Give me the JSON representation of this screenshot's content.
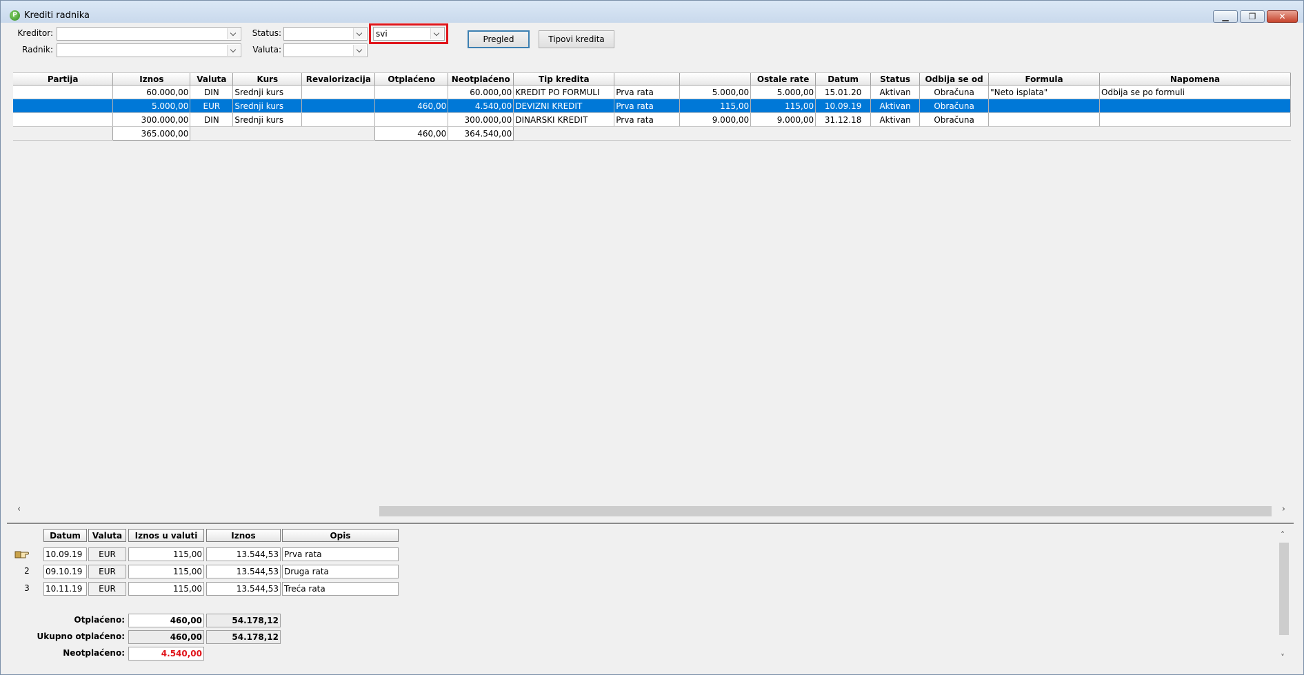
{
  "window": {
    "title": "Krediti radnika",
    "icon": "app-logo-icon"
  },
  "filters": {
    "kreditor_label": "Kreditor:",
    "kreditor_value": "",
    "radnik_label": "Radnik:",
    "radnik_value": "",
    "status_label": "Status:",
    "status_value": "",
    "valuta_label": "Valuta:",
    "valuta_value": "",
    "scope_value": "svi"
  },
  "buttons": {
    "pregled": "Pregled",
    "tipovi": "Tipovi kredita"
  },
  "grid": {
    "headers": [
      "Partija",
      "Iznos",
      "Valuta",
      "Kurs",
      "Revalorizacija",
      "Otplaćeno",
      "Neotplaćeno",
      "Tip kredita",
      "",
      "",
      "Ostale rate",
      "Datum",
      "Status",
      "Odbija se od",
      "Formula",
      "Napomena"
    ],
    "rows": [
      [
        "",
        "60.000,00",
        "DIN",
        "Srednji kurs",
        "",
        "",
        "60.000,00",
        "KREDIT PO FORMULI",
        "Prva rata",
        "5.000,00",
        "5.000,00",
        "15.01.20",
        "Aktivan",
        "Obračuna",
        "\"Neto isplata\"",
        "Odbija se po formuli"
      ],
      [
        "",
        "5.000,00",
        "EUR",
        "Srednji kurs",
        "",
        "460,00",
        "4.540,00",
        "DEVIZNI KREDIT",
        "Prva rata",
        "115,00",
        "115,00",
        "10.09.19",
        "Aktivan",
        "Obračuna",
        "",
        ""
      ],
      [
        "",
        "300.000,00",
        "DIN",
        "Srednji kurs",
        "",
        "",
        "300.000,00",
        "DINARSKI KREDIT",
        "Prva rata",
        "9.000,00",
        "9.000,00",
        "31.12.18",
        "Aktivan",
        "Obračuna",
        "",
        ""
      ]
    ],
    "selected_row": 1,
    "totals": {
      "iznos": "365.000,00",
      "otplaceno": "460,00",
      "neotplaceno": "364.540,00"
    }
  },
  "detail": {
    "headers": [
      "Datum",
      "Valuta",
      "Iznos u valuti",
      "Iznos",
      "Opis"
    ],
    "rows": [
      {
        "num": "",
        "datum": "10.09.19",
        "valuta": "EUR",
        "iznos_valuta": "115,00",
        "iznos": "13.544,53",
        "opis": "Prva rata"
      },
      {
        "num": "2",
        "datum": "09.10.19",
        "valuta": "EUR",
        "iznos_valuta": "115,00",
        "iznos": "13.544,53",
        "opis": "Druga rata"
      },
      {
        "num": "3",
        "datum": "10.11.19",
        "valuta": "EUR",
        "iznos_valuta": "115,00",
        "iznos": "13.544,53",
        "opis": "Treća rata"
      }
    ],
    "summary": {
      "otplaceno_label": "Otplaćeno:",
      "otplaceno_valuta": "460,00",
      "otplaceno_iznos": "54.178,12",
      "ukupno_label": "Ukupno otplaćeno:",
      "ukupno_valuta": "460,00",
      "ukupno_iznos": "54.178,12",
      "neotplaceno_label": "Neotplaćeno:",
      "neotplaceno_valuta": "4.540,00"
    }
  },
  "colors": {
    "selection": "#0078d7",
    "highlight_box": "#e0151b",
    "negative_value": "#e0151b"
  }
}
